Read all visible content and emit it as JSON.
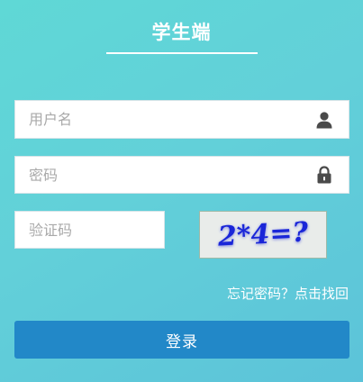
{
  "header": {
    "title": "学生端"
  },
  "form": {
    "username": {
      "placeholder": "用户名",
      "value": "",
      "icon": "user-icon"
    },
    "password": {
      "placeholder": "密码",
      "value": "",
      "icon": "lock-icon"
    },
    "captcha": {
      "placeholder": "验证码",
      "value": "",
      "image_text": "2*4=?"
    },
    "forgot_label": "忘记密码？点击找回",
    "login_label": "登录"
  },
  "colors": {
    "background_start": "#5fd8d6",
    "background_end": "#5cc3d9",
    "button": "#2288c8",
    "captcha_text": "#1a26d8",
    "icon": "#4a4a4a"
  }
}
